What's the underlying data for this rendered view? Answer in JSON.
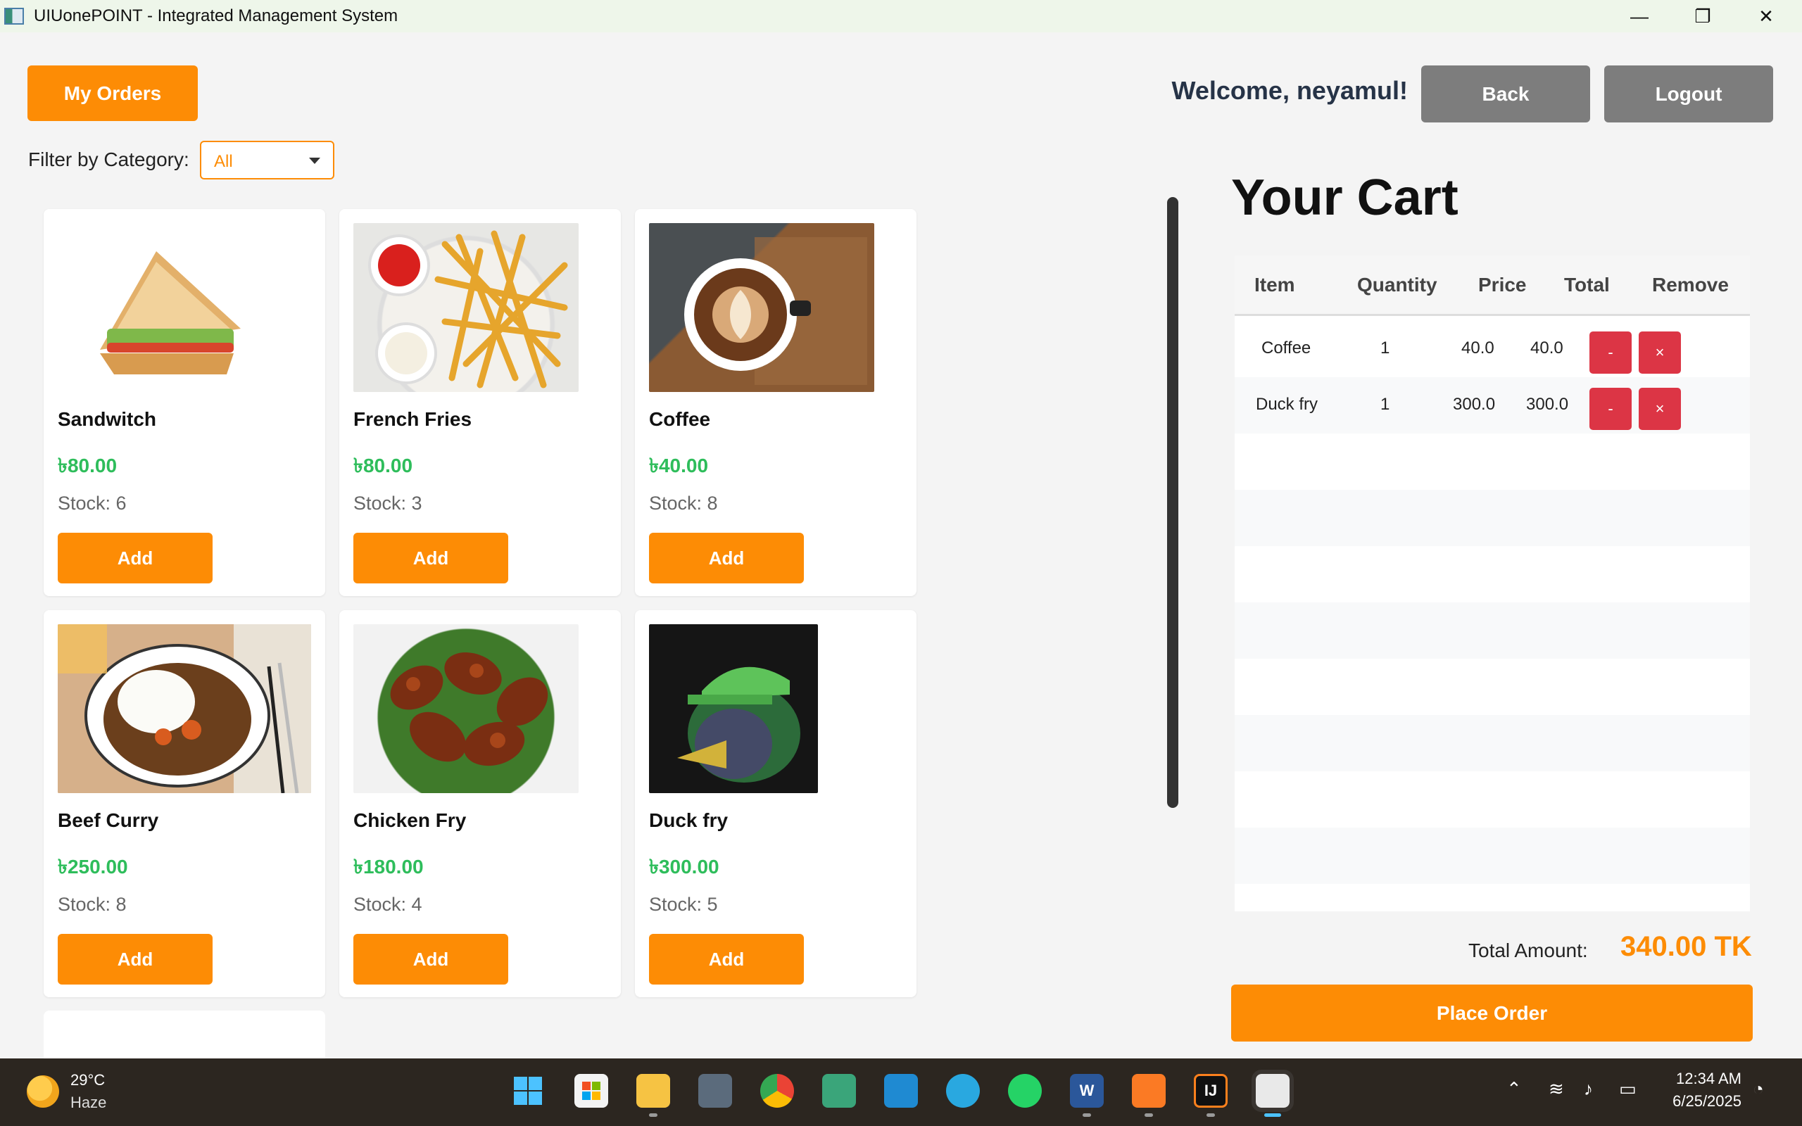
{
  "window": {
    "title": "UIUonePOINT - Integrated Management System",
    "controls": [
      "—",
      "❐",
      "✕"
    ]
  },
  "header": {
    "my_orders_label": "My Orders",
    "welcome_text": "Welcome, neyamul!",
    "back_label": "Back",
    "logout_label": "Logout"
  },
  "filter": {
    "label": "Filter by Category:",
    "selected": "All"
  },
  "products": [
    {
      "name": "Sandwitch",
      "price": "৳80.00",
      "stock": "Stock: 6",
      "add_label": "Add"
    },
    {
      "name": "French Fries",
      "price": "৳80.00",
      "stock": "Stock: 3",
      "add_label": "Add"
    },
    {
      "name": "Coffee",
      "price": "৳40.00",
      "stock": "Stock: 8",
      "add_label": "Add"
    },
    {
      "name": "Beef Curry",
      "price": "৳250.00",
      "stock": "Stock: 8",
      "add_label": "Add"
    },
    {
      "name": "Chicken Fry",
      "price": "৳180.00",
      "stock": "Stock: 4",
      "add_label": "Add"
    },
    {
      "name": "Duck fry",
      "price": "৳300.00",
      "stock": "Stock: 5",
      "add_label": "Add"
    }
  ],
  "cart": {
    "title": "Your Cart",
    "columns": [
      "Item",
      "Quantity",
      "Price",
      "Total",
      "Remove"
    ],
    "rows": [
      {
        "item": "Coffee",
        "quantity": "1",
        "price": "40.0",
        "total": "40.0",
        "minus": "-",
        "remove": "×"
      },
      {
        "item": "Duck fry",
        "quantity": "1",
        "price": "300.0",
        "total": "300.0",
        "minus": "-",
        "remove": "×"
      }
    ],
    "total_label": "Total Amount:",
    "total_value": "340.00 TK",
    "place_order_label": "Place Order"
  },
  "taskbar": {
    "weather_temp": "29°C",
    "weather_desc": "Haze",
    "time": "12:34 AM",
    "date": "6/25/2025",
    "apps": [
      "windows-start",
      "microsoft-store",
      "file-explorer",
      "keyboard-app",
      "chrome",
      "widgets-app",
      "vscode",
      "telegram",
      "whatsapp",
      "word",
      "xampp",
      "intellij",
      "java"
    ],
    "app_glyphs": {
      "word": "W",
      "intellij": "IJ"
    }
  },
  "colors": {
    "accent": "#fd8c05",
    "price_green": "#2ebd5b",
    "danger": "#dc3545",
    "grey_button": "#7d7d7d"
  }
}
